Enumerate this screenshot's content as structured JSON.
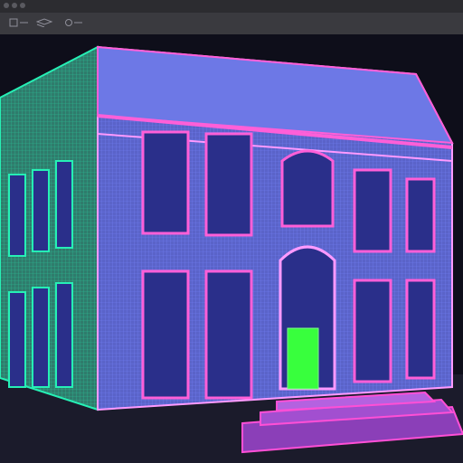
{
  "window": {
    "title": ""
  },
  "toolbar": {
    "items": [
      {
        "label": "",
        "icon": "file-icon"
      },
      {
        "label": "",
        "icon": "layers-icon"
      },
      {
        "label": "",
        "icon": "settings-icon"
      }
    ]
  },
  "viewport": {
    "scene": "wireframe-building-render",
    "colors": {
      "background": "#0e0e1a",
      "wall": "#5a63c9",
      "wall_dark": "#3b3f9c",
      "trim": "#ff5fd8",
      "trim_light": "#ff9aff",
      "side_wall": "#2f7c6c",
      "side_trim": "#26f0b5",
      "door": "#38ff3d",
      "window_fill": "#2a2f8a",
      "steps": "#ff4fd6"
    }
  }
}
